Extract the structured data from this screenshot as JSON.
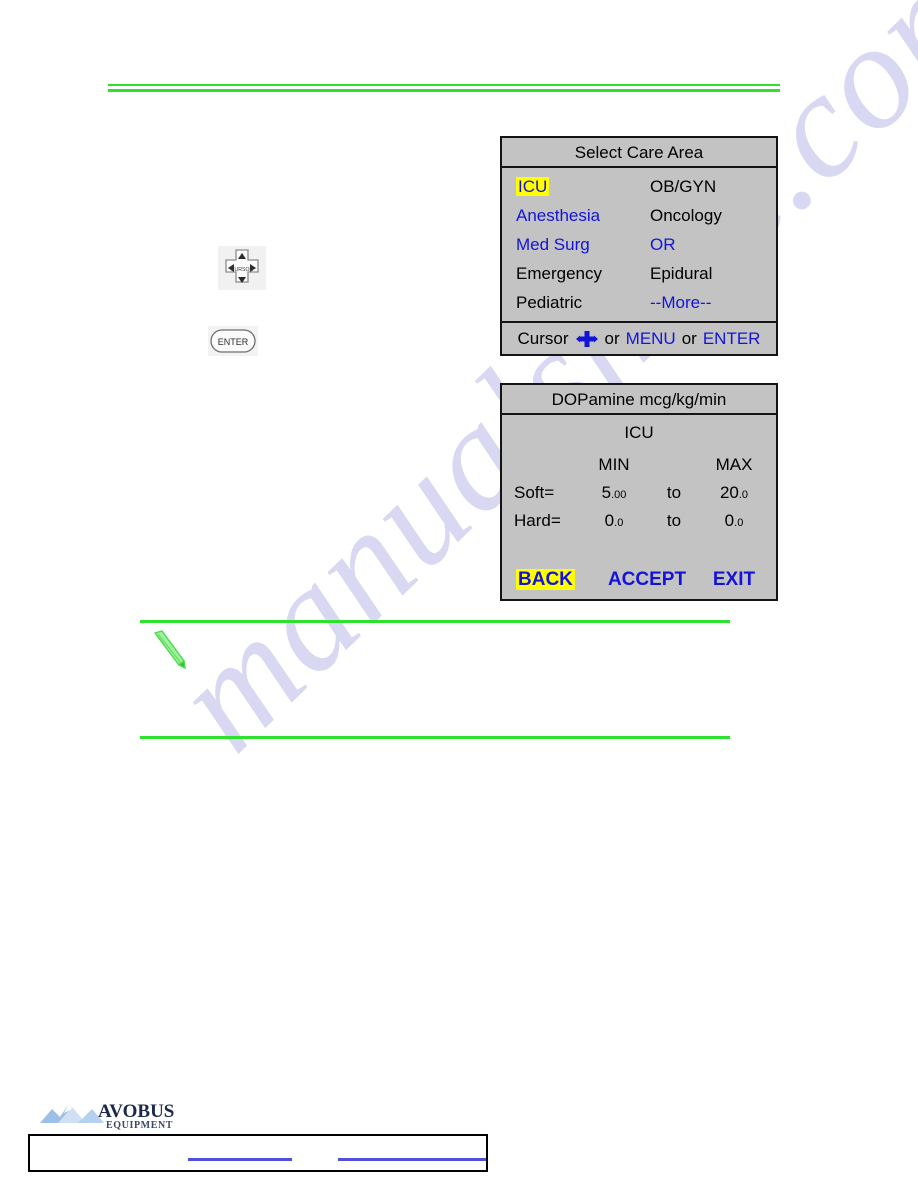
{
  "document": {
    "watermark_text": "manualshive.com"
  },
  "keypad": {
    "cursor_key_label": "CURSOR",
    "enter_key_label": "ENTER"
  },
  "care_area_panel": {
    "title": "Select Care Area",
    "rows": [
      {
        "left": {
          "label": "ICU",
          "style": "highlight"
        },
        "right": {
          "label": "OB/GYN",
          "style": "black"
        }
      },
      {
        "left": {
          "label": "Anesthesia",
          "style": "blue"
        },
        "right": {
          "label": "Oncology",
          "style": "black"
        }
      },
      {
        "left": {
          "label": "Med Surg",
          "style": "blue"
        },
        "right": {
          "label": "OR",
          "style": "blue"
        }
      },
      {
        "left": {
          "label": "Emergency",
          "style": "black"
        },
        "right": {
          "label": "Epidural",
          "style": "black"
        }
      },
      {
        "left": {
          "label": "Pediatric",
          "style": "black"
        },
        "right": {
          "label": "--More--",
          "style": "blue"
        }
      }
    ],
    "footer": {
      "cursor_label": "Cursor",
      "cross_icon": "cursor-cross-icon",
      "or_1": "or",
      "menu_label": "MENU",
      "or_2": "or",
      "enter_label": "ENTER"
    }
  },
  "limits_panel": {
    "title": "DOPamine mcg/kg/min",
    "care_area": "ICU",
    "columns": {
      "min": "MIN",
      "max": "MAX"
    },
    "separator": "to",
    "rows": [
      {
        "label": "Soft=",
        "min_int": "5",
        "min_dec": ".00",
        "sep": "to",
        "max_int": "20",
        "max_dec": ".0"
      },
      {
        "label": "Hard=",
        "min_int": "0",
        "min_dec": ".0",
        "sep": "to",
        "max_int": "0",
        "max_dec": ".0"
      }
    ],
    "buttons": {
      "back": "BACK",
      "accept": "ACCEPT",
      "exit": "EXIT"
    }
  },
  "brand": {
    "name": "AVOBUS",
    "subtitle": "EQUIPMENT"
  },
  "colors": {
    "lcd_background": "#c3c3c3",
    "lcd_border": "#141414",
    "text_black": "#000000",
    "text_blue": "#1414d8",
    "highlight_yellow": "#ffff00",
    "rule_green": "#2fe02f",
    "link_blue": "#5050d8",
    "watermark": "#b9b9e8"
  }
}
